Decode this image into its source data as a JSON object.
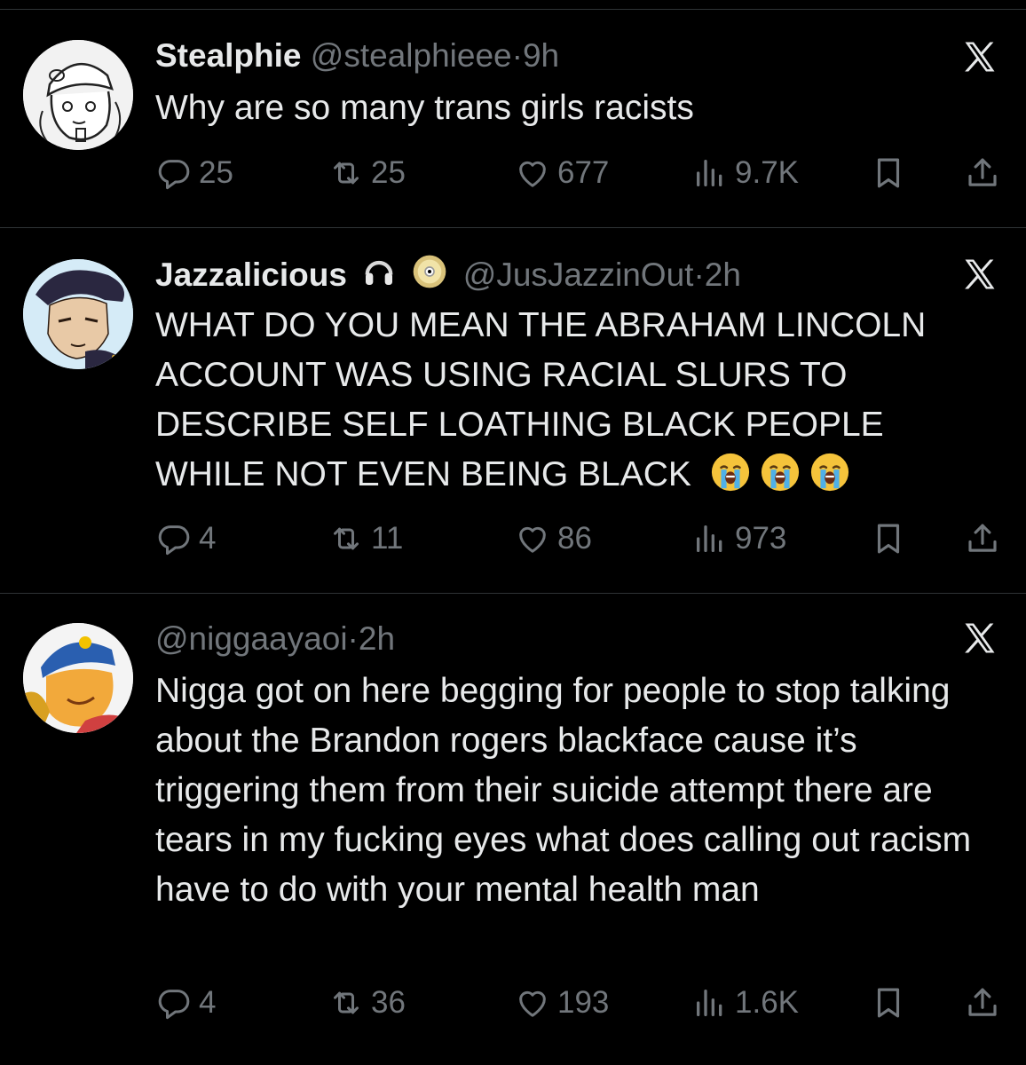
{
  "tweets": [
    {
      "name": "Stealphie",
      "handle": "@stealphieee",
      "time": "9h",
      "text": "Why are so many trans girls racists",
      "replies": "25",
      "reposts": "25",
      "likes": "677",
      "views": "9.7K"
    },
    {
      "name": "Jazzalicious",
      "handle": "@JusJazzinOut",
      "time": "2h",
      "text": "WHAT DO YOU MEAN THE ABRAHAM LINCOLN ACCOUNT WAS USING RACIAL SLURS TO DESCRIBE SELF LOATHING BLACK PEOPLE WHILE NOT EVEN BEING BLACK",
      "replies": "4",
      "reposts": "11",
      "likes": "86",
      "views": "973"
    },
    {
      "name": "",
      "handle": "@niggaayaoi",
      "time": "2h",
      "text": "Nigga got on here begging for people to stop talking about the Brandon rogers blackface cause it’s triggering them from their suicide attempt there are tears in my fucking eyes what does calling out racism have to do with your mental health man",
      "replies": "4",
      "reposts": "36",
      "likes": "193",
      "views": "1.6K"
    }
  ],
  "sep": "·",
  "colors": {
    "background": "#000000",
    "text": "#e7e9ea",
    "secondary": "#71767b",
    "divider": "#2f3336"
  },
  "icons": [
    "reply-icon",
    "repost-icon",
    "like-icon",
    "views-icon",
    "bookmark-icon",
    "share-icon",
    "x-logo-icon",
    "headphones-icon",
    "cd-icon",
    "crying-face-icon"
  ]
}
